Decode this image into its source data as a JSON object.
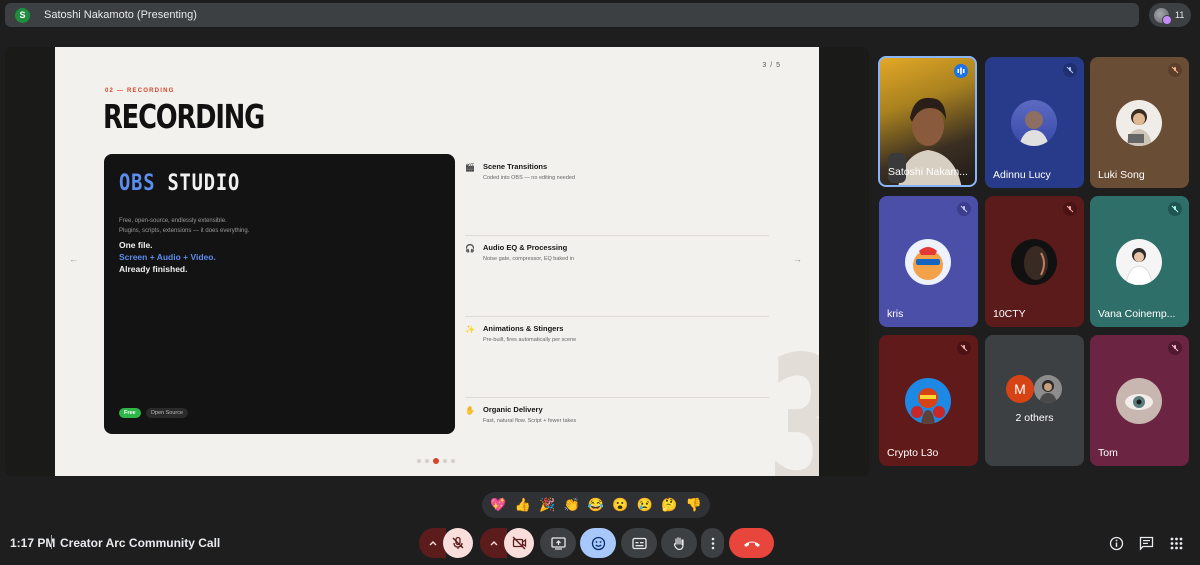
{
  "presenter_bar": {
    "avatar_initial": "S",
    "title": "Satoshi Nakamoto (Presenting)"
  },
  "participant_count": "11",
  "slide": {
    "page": "3 / 5",
    "kicker": "02 — RECORDING",
    "title": "RECORDING",
    "card": {
      "title_accent": "OBS",
      "title_rest": "STUDIO",
      "desc_line1": "Free, open-source, endlessly extensible.",
      "desc_line2": "Plugins, scripts, extensions — it does everything.",
      "line1": "One file.",
      "line2": "Screen + Audio + Video.",
      "line3": "Already finished.",
      "tag_free": "Free",
      "tag_open": "Open Source"
    },
    "features": [
      {
        "icon": "clapper-icon",
        "title": "Scene Transitions",
        "sub": "Coded into OBS — no editing needed"
      },
      {
        "icon": "headphones-icon",
        "title": "Audio EQ & Processing",
        "sub": "Noise gate, compressor, EQ baked in"
      },
      {
        "icon": "sparkle-icon",
        "title": "Animations & Stingers",
        "sub": "Pre-built, fires automatically per scene"
      },
      {
        "icon": "hand-icon",
        "title": "Organic Delivery",
        "sub": "Fast, natural flow. Script + fewer takes"
      }
    ],
    "watermark_number": "3",
    "dots_total": 5,
    "dots_active": 3
  },
  "participants": [
    {
      "name": "Satoshi Nakam...",
      "status": "speaking",
      "color": "#e3a827"
    },
    {
      "name": "Adinnu Lucy",
      "status": "muted",
      "color": "#283b8a"
    },
    {
      "name": "Luki Song",
      "status": "muted",
      "color": "#6a4d35"
    },
    {
      "name": "kris",
      "status": "muted",
      "color": "#4b4fa7"
    },
    {
      "name": "10CTY",
      "status": "muted",
      "color": "#5b1b1b"
    },
    {
      "name": "Vana Coinemp...",
      "status": "muted",
      "color": "#2e6f69"
    },
    {
      "name": "Crypto L3o",
      "status": "muted",
      "color": "#611a1a"
    },
    {
      "name": "2 others",
      "status": "group",
      "initial": "M",
      "color": "#3c4043"
    },
    {
      "name": "Tom",
      "status": "muted",
      "color": "#6b2441"
    }
  ],
  "reactions": [
    "💖",
    "👍",
    "🎉",
    "👏",
    "😂",
    "😮",
    "😢",
    "🤔",
    "👎"
  ],
  "bottom": {
    "time": "1:17 PM",
    "meeting_name": "Creator Arc Community Call"
  },
  "colors": {
    "end_call": "#e8453c",
    "muted_bg": "#f9dedc",
    "active_blue": "#a8c7fa",
    "control_gray": "#3c4043"
  }
}
